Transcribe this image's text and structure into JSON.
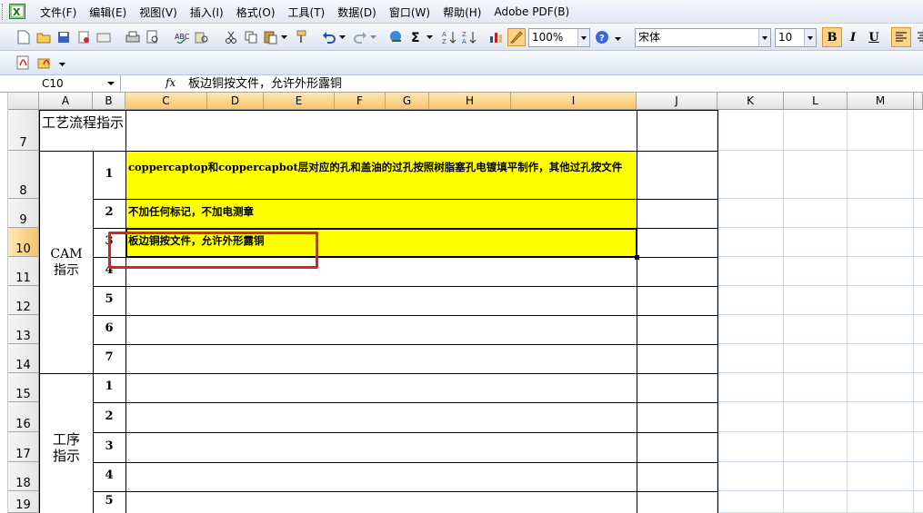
{
  "menu": [
    "文件(F)",
    "编辑(E)",
    "视图(V)",
    "插入(I)",
    "格式(O)",
    "工具(T)",
    "数据(D)",
    "窗口(W)",
    "帮助(H)",
    "Adobe PDF(B)"
  ],
  "toolbar": {
    "zoom": "100%",
    "font": "宋体",
    "font_size": "10",
    "bold": "B",
    "italic": "I",
    "underline": "U"
  },
  "formula_bar": {
    "name_box": "C10",
    "fx": "fx",
    "content": "板边铜按文件，允许外形露铜"
  },
  "columns": [
    "A",
    "B",
    "C",
    "D",
    "E",
    "F",
    "G",
    "H",
    "I",
    "J",
    "K",
    "L",
    "M"
  ],
  "rows": [
    "7",
    "8",
    "9",
    "10",
    "11",
    "12",
    "13",
    "14",
    "15",
    "16",
    "17",
    "18",
    "19"
  ],
  "sheet": {
    "process_guide": "工艺流程指示",
    "cam_guide": "CAM指示",
    "step_guide": "工序指示",
    "cam_items": [
      {
        "no": "1",
        "text": "coppercaptop和coppercapbot层对应的孔和盖油的过孔按照树脂塞孔电镀填平制作，其他过孔按文件"
      },
      {
        "no": "2",
        "text": "不加任何标记，不加电测章"
      },
      {
        "no": "3",
        "text": "板边铜按文件，允许外形露铜"
      },
      {
        "no": "4",
        "text": ""
      },
      {
        "no": "5",
        "text": ""
      },
      {
        "no": "6",
        "text": ""
      },
      {
        "no": "7",
        "text": ""
      }
    ],
    "step_items": [
      "1",
      "2",
      "3",
      "4",
      "5"
    ]
  },
  "colors": {
    "highlight_fill": "#ffff00",
    "annotation_border": "#e02020",
    "selected_header": "#f6c46a"
  }
}
